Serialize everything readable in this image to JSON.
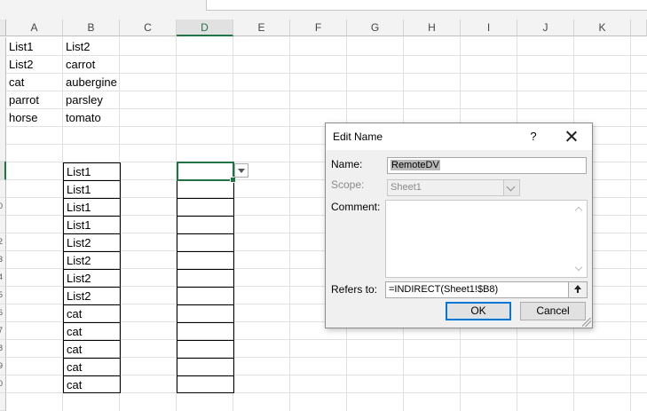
{
  "sheet": {
    "columns": [
      "A",
      "B",
      "C",
      "D",
      "E",
      "F",
      "G",
      "H",
      "I",
      "J",
      "K"
    ],
    "selected_column": "D",
    "rows": [
      {
        "A": "List1",
        "B": "List2"
      },
      {
        "A": "List2",
        "B": "carrot"
      },
      {
        "A": "cat",
        "B": "aubergine"
      },
      {
        "A": "parrot",
        "B": "parsley"
      },
      {
        "A": "horse",
        "B": "tomato"
      }
    ],
    "row_header_fragments": [
      "0",
      "2",
      "3",
      "4",
      "5",
      "6",
      "7",
      "8",
      "9",
      "0"
    ],
    "boxed_list": [
      "List1",
      "List1",
      "List1",
      "List1",
      "List2",
      "List2",
      "List2",
      "List2",
      "cat",
      "cat",
      "cat",
      "cat",
      "cat"
    ]
  },
  "dialog": {
    "title": "Edit Name",
    "help": "?",
    "name_label": "Name:",
    "name_value": "RemoteDV",
    "scope_label": "Scope:",
    "scope_value": "Sheet1",
    "comment_label": "Comment:",
    "comment_value": "",
    "refers_label": "Refers to:",
    "refers_value": "=INDIRECT(Sheet1!$B8)",
    "ok_label": "OK",
    "cancel_label": "Cancel"
  }
}
